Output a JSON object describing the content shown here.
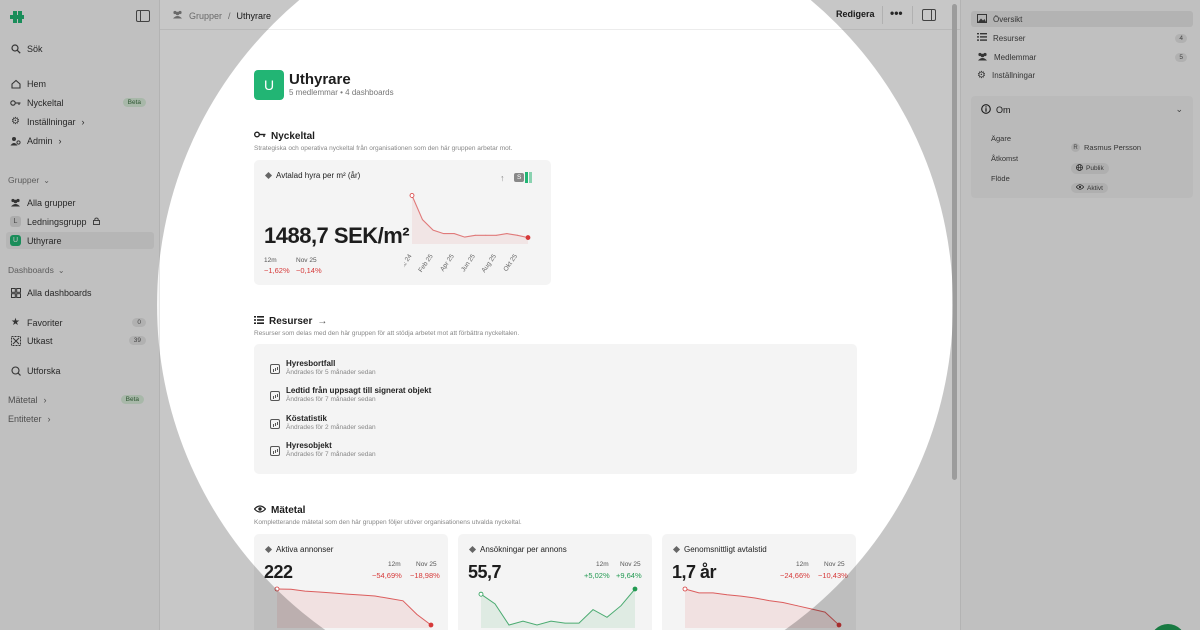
{
  "sidebar": {
    "search": "Sök",
    "items": [
      {
        "label": "Hem"
      },
      {
        "label": "Nyckeltal",
        "badge": "Beta"
      },
      {
        "label": "Inställningar"
      },
      {
        "label": "Admin"
      }
    ],
    "groups_label": "Grupper",
    "groups": [
      {
        "label": "Alla grupper"
      },
      {
        "label": "Ledningsgrupp",
        "avatar": "L"
      },
      {
        "label": "Uthyrare",
        "avatar": "U"
      }
    ],
    "dashboards_label": "Dashboards",
    "dashboards": [
      {
        "label": "Alla dashboards"
      }
    ],
    "favorites": {
      "label": "Favoriter",
      "count": "0"
    },
    "drafts": {
      "label": "Utkast",
      "count": "39"
    },
    "explore": "Utforska",
    "metrics": {
      "label": "Mätetal",
      "badge": "Beta"
    },
    "entities": "Entiteter"
  },
  "topbar": {
    "breadcrumb_root": "Grupper",
    "breadcrumb_sep": "/",
    "breadcrumb_current": "Uthyrare",
    "edit_label": "Redigera",
    "more_label": "•••"
  },
  "group": {
    "avatar": "U",
    "title": "Uthyrare",
    "subtitle": "5 medlemmar • 4 dashboards"
  },
  "kpi_section": {
    "title": "Nyckeltal",
    "description": "Strategiska och operativa nyckeltal från organisationen som den här gruppen arbetar mot.",
    "card": {
      "title": "Avtalad hyra per m² (år)",
      "toggle_label": "S",
      "value": "1488,7 SEK/m²",
      "d1_label": "12m",
      "d1_value": "−1,62%",
      "d2_label": "Nov 25",
      "d2_value": "−0,14%",
      "x_ticks": [
        "Dec 24",
        "Feb 25",
        "Apr 25",
        "Jun 25",
        "Aug 25",
        "Okt 25"
      ]
    }
  },
  "resources_section": {
    "title": "Resurser",
    "description": "Resurser som delas med den här gruppen för att stödja arbetet mot att förbättra nyckeltalen.",
    "items": [
      {
        "name": "Hyresbortfall",
        "updated": "Ändrades för 5 månader sedan"
      },
      {
        "name": "Ledtid från uppsagt till signerat objekt",
        "updated": "Ändrades för 7 månader sedan"
      },
      {
        "name": "Köstatistik",
        "updated": "Ändrades för 2 månader sedan"
      },
      {
        "name": "Hyresobjekt",
        "updated": "Ändrades för 7 månader sedan"
      }
    ]
  },
  "metrics_section": {
    "title": "Mätetal",
    "description": "Kompletterande mätetal som den här gruppen följer utöver organisationens utvalda nyckeltal.",
    "cards": [
      {
        "title": "Aktiva annonser",
        "value": "222",
        "d1_label": "12m",
        "d1_value": "−54,69%",
        "d2_label": "Nov 25",
        "d2_value": "−18,98%"
      },
      {
        "title": "Ansökningar per annons",
        "value": "55,7",
        "d1_label": "12m",
        "d1_value": "+5,02%",
        "d2_label": "Nov 25",
        "d2_value": "+9,64%"
      },
      {
        "title": "Genomsnittligt avtalstid",
        "value": "1,7 år",
        "d1_label": "12m",
        "d1_value": "−24,66%",
        "d2_label": "Nov 25",
        "d2_value": "−10,43%"
      }
    ]
  },
  "right_panel": {
    "items": [
      {
        "label": "Översikt"
      },
      {
        "label": "Resurser",
        "count": "4"
      },
      {
        "label": "Medlemmar",
        "count": "5"
      },
      {
        "label": "Inställningar"
      }
    ],
    "about": {
      "title": "Om",
      "owner_label": "Ägare",
      "owner_initial": "R",
      "owner_value": "Rasmus Persson",
      "access_label": "Åtkomst",
      "access_value": "Publik",
      "flow_label": "Flöde",
      "flow_value": "Aktivt"
    }
  },
  "colors": {
    "brand": "#22b574",
    "negative": "#d63a3a",
    "positive": "#239a52",
    "overlay": "#000000"
  },
  "chart_data": [
    {
      "type": "line",
      "title": "Avtalad hyra per m² (år)",
      "x": [
        "Dec 24",
        "Jan 25",
        "Feb 25",
        "Mar 25",
        "Apr 25",
        "Maj 25",
        "Jun 25",
        "Jul 25",
        "Aug 25",
        "Sep 25",
        "Okt 25",
        "Nov 25"
      ],
      "values": [
        1513,
        1499,
        1493,
        1491,
        1491,
        1489,
        1490,
        1490,
        1490,
        1491,
        1490,
        1488.7
      ]
    },
    {
      "type": "area",
      "title": "Aktiva annonser",
      "values": [
        490,
        488,
        474,
        468,
        460,
        452,
        445,
        438,
        420,
        402,
        300,
        222
      ]
    },
    {
      "type": "area",
      "title": "Ansökningar per annons",
      "values": [
        53,
        48,
        37,
        39,
        37,
        39,
        38,
        38,
        45,
        41,
        47,
        55.7
      ]
    },
    {
      "type": "area",
      "title": "Genomsnittligt avtalstid",
      "values": [
        2.26,
        2.2,
        2.2,
        2.17,
        2.15,
        2.12,
        2.08,
        2.05,
        2.0,
        1.95,
        1.9,
        1.7
      ]
    }
  ]
}
